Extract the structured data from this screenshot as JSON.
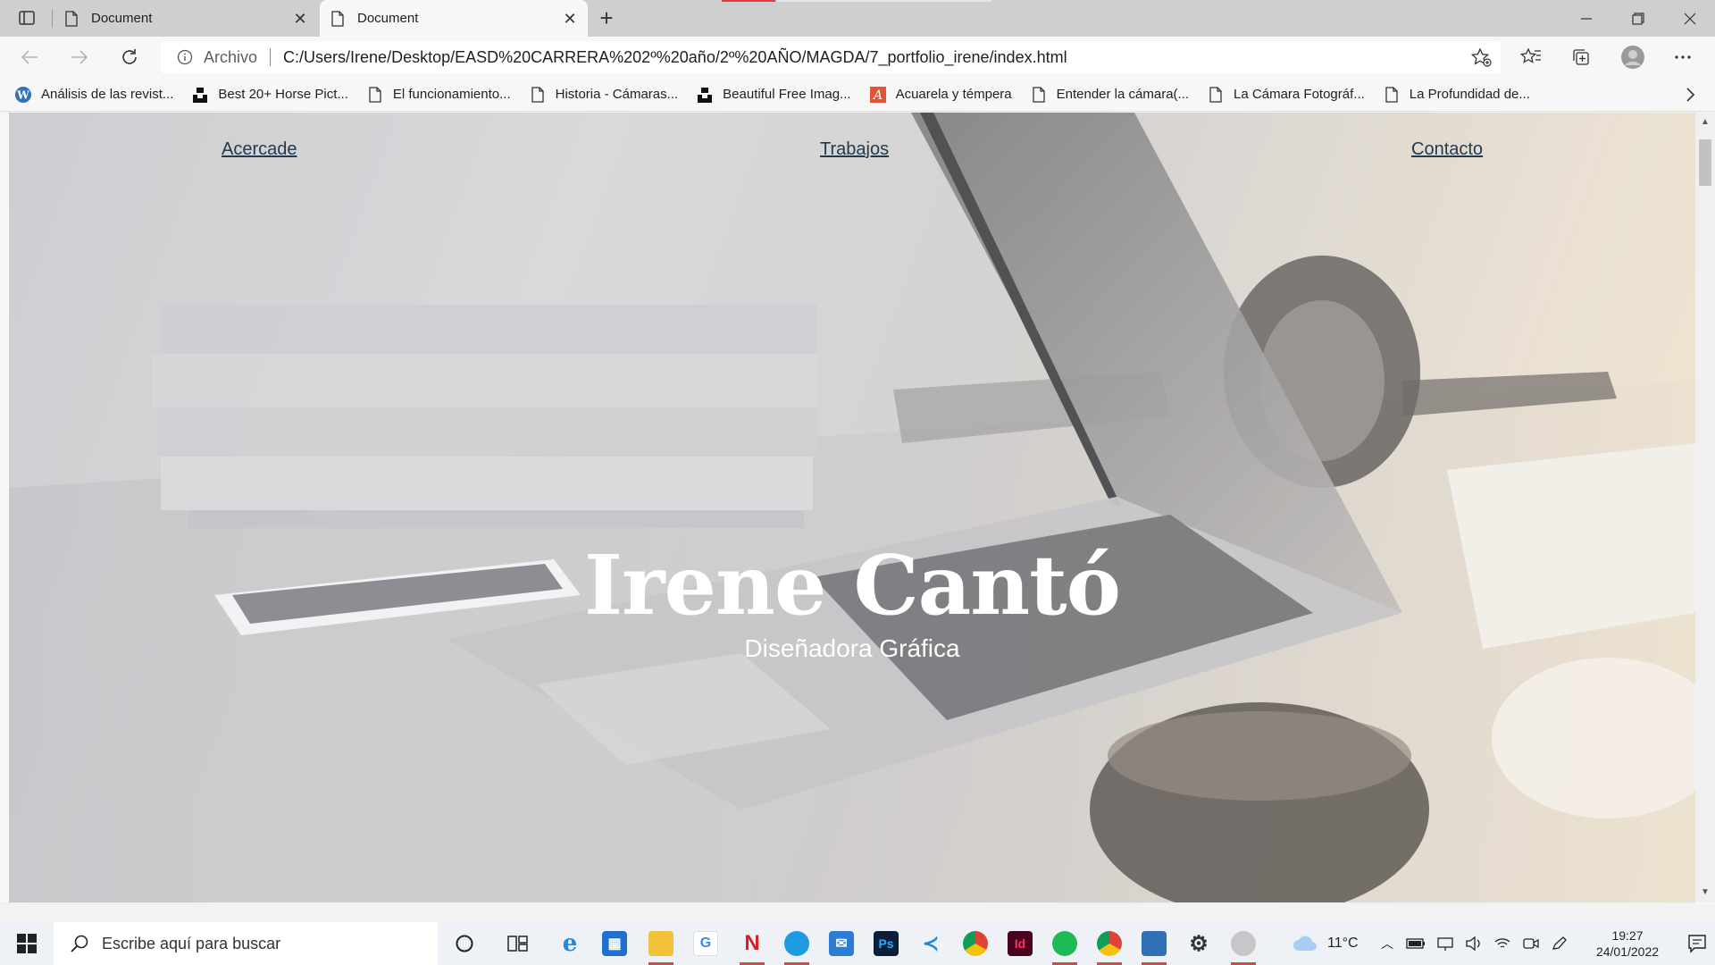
{
  "browser": {
    "tabs": [
      {
        "title": "Document",
        "active": false
      },
      {
        "title": "Document",
        "active": true
      }
    ],
    "address": {
      "scheme_label": "Archivo",
      "url": "C:/Users/Irene/Desktop/EASD%20CARRERA%202º%20año/2º%20AÑO/MAGDA/7_portfolio_irene/index.html"
    },
    "bookmarks": [
      {
        "label": "Análisis de las revist...",
        "icon": "wordpress-icon"
      },
      {
        "label": "Best 20+ Horse Pict...",
        "icon": "unsplash-icon"
      },
      {
        "label": "El funcionamiento...",
        "icon": "page-icon"
      },
      {
        "label": "Historia - Cámaras...",
        "icon": "page-icon"
      },
      {
        "label": "Beautiful Free Imag...",
        "icon": "unsplash-icon"
      },
      {
        "label": "Acuarela y témpera",
        "icon": "acuarela-icon"
      },
      {
        "label": "Entender la cámara(...",
        "icon": "page-icon"
      },
      {
        "label": "La Cámara Fotográf...",
        "icon": "page-icon"
      },
      {
        "label": "La Profundidad de...",
        "icon": "page-icon"
      }
    ]
  },
  "page": {
    "nav": {
      "about": "Acercade",
      "works": "Trabajos",
      "contact": "Contacto"
    },
    "hero": {
      "title": "Irene Cantó",
      "subtitle": "Diseñadora Gráfica"
    }
  },
  "taskbar": {
    "search_placeholder": "Escribe aquí para buscar",
    "temperature": "11°C",
    "time": "19:27",
    "date": "24/01/2022",
    "apps": [
      "cortana-icon",
      "task-view-icon",
      "internet-explorer-icon",
      "microsoft-store-icon",
      "file-explorer-icon",
      "google-icon",
      "netflix-icon",
      "edge-icon",
      "mail-icon",
      "photoshop-icon",
      "vscode-icon",
      "chrome-icon",
      "indesign-icon",
      "spotify-icon",
      "chrome-profile-icon",
      "photos-icon",
      "settings-icon",
      "media-player-icon"
    ]
  },
  "colors": {
    "nav_link": "#243a4c",
    "hero_text": "#ffffff",
    "tabstrip": "#cfcfcf"
  }
}
